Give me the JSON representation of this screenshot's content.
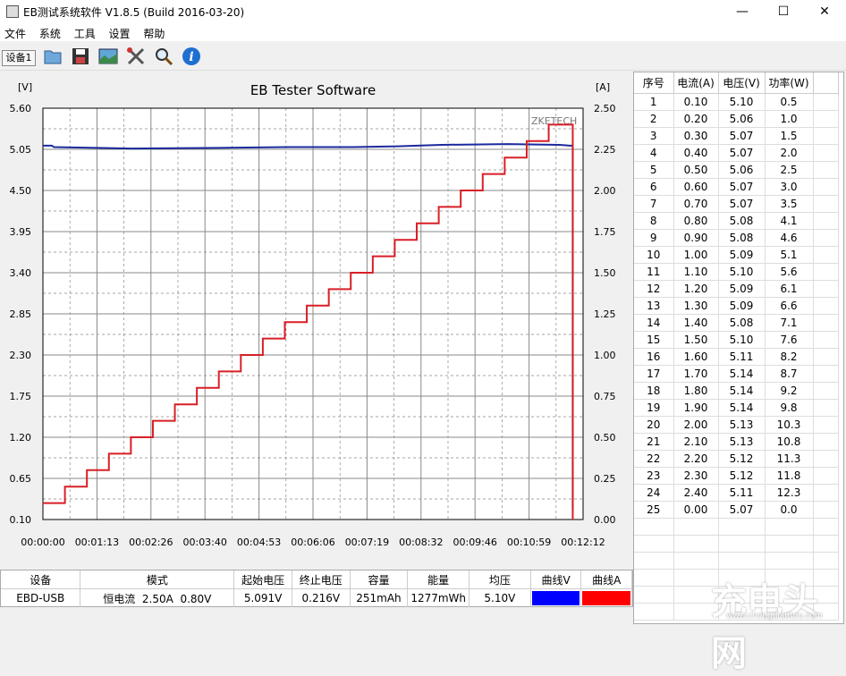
{
  "window": {
    "title": "EB测试系统软件 V1.8.5 (Build 2016-03-20)"
  },
  "menu": [
    "文件",
    "系统",
    "工具",
    "设置",
    "帮助"
  ],
  "toolbar": {
    "device_button": "设备1"
  },
  "chart_data": {
    "type": "line",
    "title": "EB Tester Software",
    "watermark": "ZKETECH",
    "ylabel_left": "[V]",
    "ylabel_right": "[A]",
    "y_left_ticks": [
      "5.60",
      "5.05",
      "4.50",
      "3.95",
      "3.40",
      "2.85",
      "2.30",
      "1.75",
      "1.20",
      "0.65",
      "0.10"
    ],
    "y_right_ticks": [
      "2.50",
      "2.25",
      "2.00",
      "1.75",
      "1.50",
      "1.25",
      "1.00",
      "0.75",
      "0.50",
      "0.25",
      "0.00"
    ],
    "x_ticks": [
      "00:00:00",
      "00:01:13",
      "00:02:26",
      "00:03:40",
      "00:04:53",
      "00:06:06",
      "00:07:19",
      "00:08:32",
      "00:09:46",
      "00:10:59",
      "00:12:12"
    ],
    "ylim_left": [
      0.1,
      5.6
    ],
    "ylim_right": [
      0.0,
      2.5
    ],
    "xlim_seconds": [
      0,
      732
    ],
    "grid": true,
    "series": [
      {
        "name": "曲线V",
        "color": "#1a2a9c",
        "axis": "left",
        "points": [
          [
            0,
            5.1
          ],
          [
            12,
            5.1
          ],
          [
            15,
            5.08
          ],
          [
            120,
            5.06
          ],
          [
            240,
            5.07
          ],
          [
            330,
            5.08
          ],
          [
            420,
            5.08
          ],
          [
            480,
            5.09
          ],
          [
            540,
            5.11
          ],
          [
            630,
            5.12
          ],
          [
            700,
            5.11
          ],
          [
            713,
            5.1
          ],
          [
            718,
            5.1
          ],
          [
            718,
            0.216
          ]
        ]
      },
      {
        "name": "曲线A",
        "color": "#d81f26",
        "axis": "right",
        "steps": [
          0.1,
          0.2,
          0.3,
          0.4,
          0.5,
          0.6,
          0.7,
          0.8,
          0.9,
          1.0,
          1.1,
          1.2,
          1.3,
          1.4,
          1.5,
          1.6,
          1.7,
          1.8,
          1.9,
          2.0,
          2.1,
          2.2,
          2.3,
          2.4,
          0.0
        ],
        "step_seconds": 29.8
      }
    ]
  },
  "table": {
    "headers": [
      "序号",
      "电流(A)",
      "电压(V)",
      "功率(W)"
    ],
    "rows": [
      [
        "1",
        "0.10",
        "5.10",
        "0.5"
      ],
      [
        "2",
        "0.20",
        "5.06",
        "1.0"
      ],
      [
        "3",
        "0.30",
        "5.07",
        "1.5"
      ],
      [
        "4",
        "0.40",
        "5.07",
        "2.0"
      ],
      [
        "5",
        "0.50",
        "5.06",
        "2.5"
      ],
      [
        "6",
        "0.60",
        "5.07",
        "3.0"
      ],
      [
        "7",
        "0.70",
        "5.07",
        "3.5"
      ],
      [
        "8",
        "0.80",
        "5.08",
        "4.1"
      ],
      [
        "9",
        "0.90",
        "5.08",
        "4.6"
      ],
      [
        "10",
        "1.00",
        "5.09",
        "5.1"
      ],
      [
        "11",
        "1.10",
        "5.10",
        "5.6"
      ],
      [
        "12",
        "1.20",
        "5.09",
        "6.1"
      ],
      [
        "13",
        "1.30",
        "5.09",
        "6.6"
      ],
      [
        "14",
        "1.40",
        "5.08",
        "7.1"
      ],
      [
        "15",
        "1.50",
        "5.10",
        "7.6"
      ],
      [
        "16",
        "1.60",
        "5.11",
        "8.2"
      ],
      [
        "17",
        "1.70",
        "5.14",
        "8.7"
      ],
      [
        "18",
        "1.80",
        "5.14",
        "9.2"
      ],
      [
        "19",
        "1.90",
        "5.14",
        "9.8"
      ],
      [
        "20",
        "2.00",
        "5.13",
        "10.3"
      ],
      [
        "21",
        "2.10",
        "5.13",
        "10.8"
      ],
      [
        "22",
        "2.20",
        "5.12",
        "11.3"
      ],
      [
        "23",
        "2.30",
        "5.12",
        "11.8"
      ],
      [
        "24",
        "2.40",
        "5.11",
        "12.3"
      ],
      [
        "25",
        "0.00",
        "5.07",
        "0.0"
      ]
    ]
  },
  "status": {
    "headers": [
      "设备",
      "模式",
      "起始电压",
      "终止电压",
      "容量",
      "能量",
      "均压",
      "曲线V",
      "曲线A"
    ],
    "values": [
      "EBD-USB",
      "恒电流  2.50A  0.80V",
      "5.091V",
      "0.216V",
      "251mAh",
      "1277mWh",
      "5.10V"
    ],
    "colors": {
      "curve_v": "#0000ff",
      "curve_a": "#ff0000"
    }
  },
  "watermark": "充电头网",
  "watermark_url": "www.chongdiantou.com"
}
